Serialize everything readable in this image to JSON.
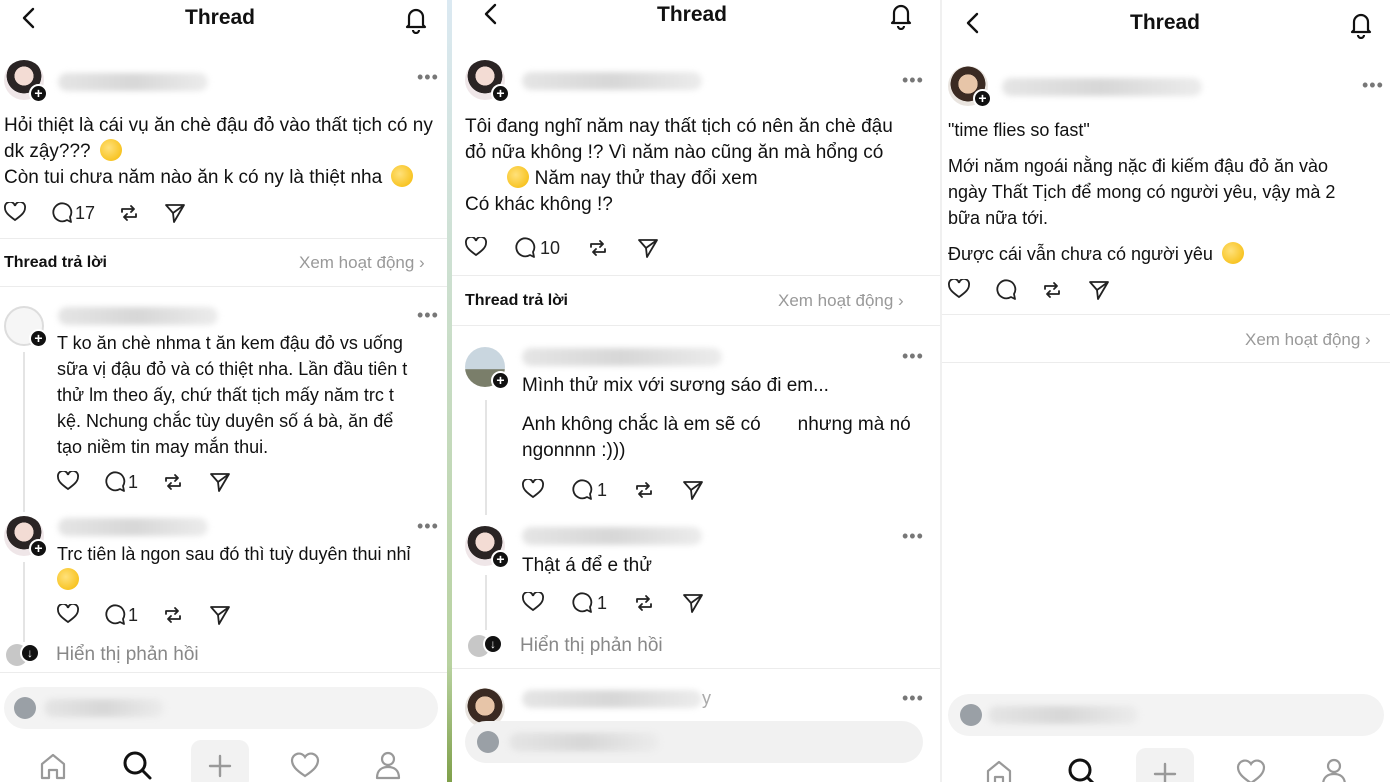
{
  "header": {
    "title": "Thread"
  },
  "panel1": {
    "post": {
      "text": "Hỏi thiệt là cái vụ ăn chè đậu đỏ vào thất tịch có ny\ndk zậy??? ",
      "text2": "Còn tui chưa năm nào ăn k có ny là thiệt nha ",
      "replies": "17"
    },
    "section": {
      "label": "Thread trả lời",
      "link": "Xem hoạt động"
    },
    "reply1": {
      "text": "T ko ăn chè nhma t ăn kem đậu đỏ vs uống\nsữa vị đậu đỏ và có thiệt nha. Lần đầu tiên t\nthử lm theo ấy, chứ thất tịch mấy năm trc t\nkệ. Nchung chắc tùy duyên số á bà, ăn để\ntạo niềm tin may mắn thui.",
      "replies": "1"
    },
    "reply2": {
      "text": "Trc tiên là ngon sau đó thì tuỳ duyên thui nhỉ",
      "replies": "1"
    },
    "show_replies": "Hiển thị phản hồi"
  },
  "panel2": {
    "post": {
      "text": "Tôi đang nghĩ năm nay thất tịch có nên ăn chè đậu\nđỏ nữa không !? Vì năm nào cũng ăn mà hổng có",
      "text2": " Năm nay thử thay đổi xem",
      "text3": "Có khác không !?",
      "replies": "10"
    },
    "section": {
      "label": "Thread trả lời",
      "link": "Xem hoạt động"
    },
    "reply1": {
      "text": "Mình thử mix với sương sáo đi em...",
      "text2": "Anh không chắc là em sẽ có       nhưng mà nó\nngonnnn :)))",
      "replies": "1"
    },
    "reply2": {
      "text": "Thật á để e thử",
      "replies": "1"
    },
    "show_replies": "Hiển thị phản hồi",
    "peek_suffix": "y"
  },
  "panel3": {
    "post": {
      "quote": "\"time flies so fast\"",
      "text": "Mới năm ngoái nằng nặc đi kiếm đậu đỏ ăn vào\nngày Thất Tịch để mong có người yêu, vậy mà 2\nbữa nữa tới.",
      "text2": "Được cái vẫn chưa có người yêu "
    },
    "section": {
      "link": "Xem hoạt động"
    }
  },
  "icons": [
    "back-icon",
    "bell-icon",
    "heart-icon",
    "comment-icon",
    "repost-icon",
    "share-icon",
    "home-icon",
    "search-icon",
    "plus-icon",
    "activity-heart-icon",
    "profile-icon",
    "more-icon",
    "chevron-right-icon"
  ]
}
